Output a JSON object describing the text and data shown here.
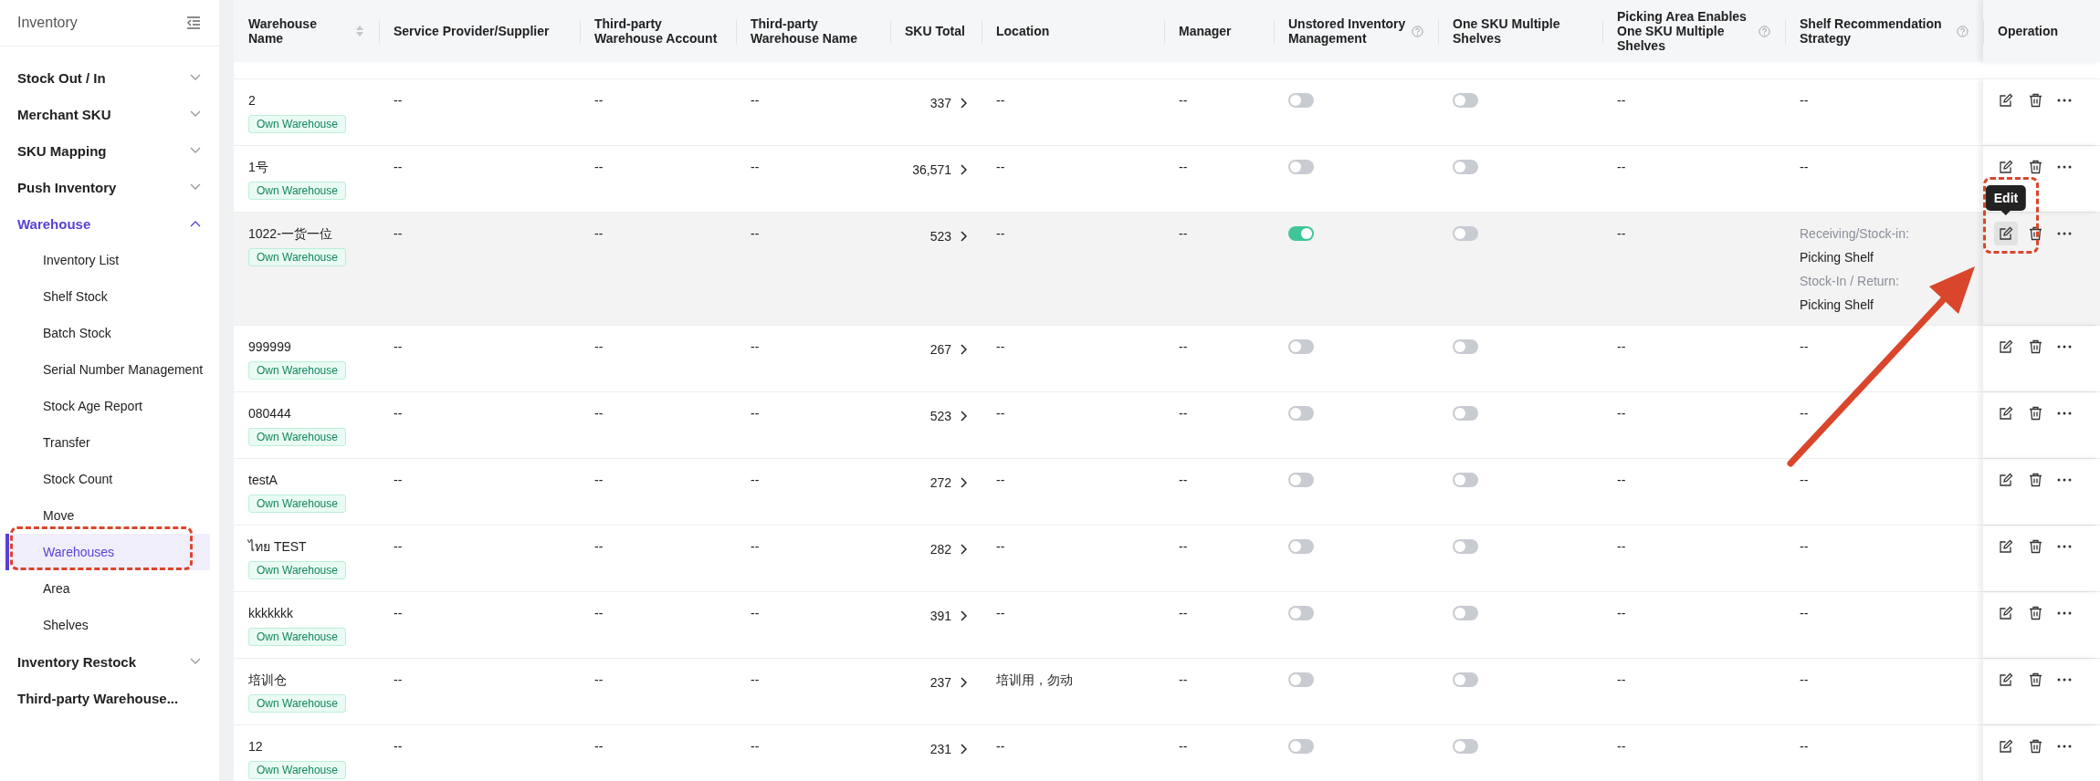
{
  "sidebar": {
    "title": "Inventory",
    "items": [
      {
        "kind": "group",
        "label": "Stock Out / In",
        "expanded": false
      },
      {
        "kind": "group",
        "label": "Merchant SKU",
        "expanded": false
      },
      {
        "kind": "group",
        "label": "SKU Mapping",
        "expanded": false
      },
      {
        "kind": "group",
        "label": "Push Inventory",
        "expanded": false
      },
      {
        "kind": "group",
        "label": "Warehouse",
        "expanded": true,
        "children": [
          {
            "label": "Inventory List",
            "selected": false
          },
          {
            "label": "Shelf Stock",
            "selected": false
          },
          {
            "label": "Batch Stock",
            "selected": false
          },
          {
            "label": "Serial Number Management",
            "selected": false
          },
          {
            "label": "Stock Age Report",
            "selected": false
          },
          {
            "label": "Transfer",
            "selected": false
          },
          {
            "label": "Stock Count",
            "selected": false
          },
          {
            "label": "Move",
            "selected": false
          },
          {
            "label": "Warehouses",
            "selected": true
          },
          {
            "label": "Area",
            "selected": false
          },
          {
            "label": "Shelves",
            "selected": false
          }
        ]
      },
      {
        "kind": "group",
        "label": "Inventory Restock",
        "expanded": false
      },
      {
        "kind": "link",
        "label": "Third-party Warehouse..."
      }
    ]
  },
  "table": {
    "columns": [
      {
        "label": "Warehouse Name",
        "sortable": true,
        "help": false
      },
      {
        "label": "Service Provider/Supplier",
        "sortable": false,
        "help": false
      },
      {
        "label": "Third-party Warehouse Account",
        "sortable": false,
        "help": false
      },
      {
        "label": "Third-party Warehouse Name",
        "sortable": false,
        "help": false
      },
      {
        "label": "SKU Total",
        "sortable": false,
        "help": false
      },
      {
        "label": "Location",
        "sortable": false,
        "help": false
      },
      {
        "label": "Manager",
        "sortable": false,
        "help": false
      },
      {
        "label": "Unstored Inventory Management",
        "sortable": false,
        "help": true
      },
      {
        "label": "One SKU Multiple Shelves",
        "sortable": false,
        "help": false
      },
      {
        "label": "Picking Area Enables One SKU Multiple Shelves",
        "sortable": false,
        "help": true
      },
      {
        "label": "Shelf Recommendation Strategy",
        "sortable": false,
        "help": true
      },
      {
        "label": "Operation",
        "sortable": false,
        "help": false
      }
    ],
    "rows": [
      {
        "name": "2",
        "tag": "Own Warehouse",
        "provider": "--",
        "account": "--",
        "tp_name": "--",
        "sku": "337",
        "location": "--",
        "manager": "--",
        "unstored": false,
        "multi_shelf": false,
        "picking": "--",
        "strategy": "--",
        "highlighted": false
      },
      {
        "name": "1号",
        "tag": "Own Warehouse",
        "provider": "--",
        "account": "--",
        "tp_name": "--",
        "sku": "36,571",
        "location": "--",
        "manager": "--",
        "unstored": false,
        "multi_shelf": false,
        "picking": "--",
        "strategy": "--",
        "highlighted": false
      },
      {
        "name": "1022-一货一位",
        "tag": "Own Warehouse",
        "provider": "--",
        "account": "--",
        "tp_name": "--",
        "sku": "523",
        "location": "--",
        "manager": "--",
        "unstored": true,
        "multi_shelf": false,
        "picking": "--",
        "strategy_lines": [
          {
            "label": "Receiving/Stock-in:",
            "value": "Picking Shelf"
          },
          {
            "label": "Stock-In / Return:",
            "value": "Picking Shelf"
          }
        ],
        "highlighted": true,
        "tooltip": "Edit"
      },
      {
        "name": "999999",
        "tag": "Own Warehouse",
        "provider": "--",
        "account": "--",
        "tp_name": "--",
        "sku": "267",
        "location": "--",
        "manager": "--",
        "unstored": false,
        "multi_shelf": false,
        "picking": "--",
        "strategy": "--",
        "highlighted": false
      },
      {
        "name": "080444",
        "tag": "Own Warehouse",
        "provider": "--",
        "account": "--",
        "tp_name": "--",
        "sku": "523",
        "location": "--",
        "manager": "--",
        "unstored": false,
        "multi_shelf": false,
        "picking": "--",
        "strategy": "--",
        "highlighted": false
      },
      {
        "name": "testA",
        "tag": "Own Warehouse",
        "provider": "--",
        "account": "--",
        "tp_name": "--",
        "sku": "272",
        "location": "--",
        "manager": "--",
        "unstored": false,
        "multi_shelf": false,
        "picking": "--",
        "strategy": "--",
        "highlighted": false
      },
      {
        "name": "ไทย TEST",
        "tag": "Own Warehouse",
        "provider": "--",
        "account": "--",
        "tp_name": "--",
        "sku": "282",
        "location": "--",
        "manager": "--",
        "unstored": false,
        "multi_shelf": false,
        "picking": "--",
        "strategy": "--",
        "highlighted": false
      },
      {
        "name": "kkkkkkk",
        "tag": "Own Warehouse",
        "provider": "--",
        "account": "--",
        "tp_name": "--",
        "sku": "391",
        "location": "--",
        "manager": "--",
        "unstored": false,
        "multi_shelf": false,
        "picking": "--",
        "strategy": "--",
        "highlighted": false
      },
      {
        "name": "培训仓",
        "tag": "Own Warehouse",
        "provider": "--",
        "account": "--",
        "tp_name": "--",
        "sku": "237",
        "location": "培训用，勿动",
        "manager": "--",
        "unstored": false,
        "multi_shelf": false,
        "picking": "--",
        "strategy": "--",
        "highlighted": false
      },
      {
        "name": "12",
        "tag": "Own Warehouse",
        "provider": "--",
        "account": "--",
        "tp_name": "--",
        "sku": "231",
        "location": "--",
        "manager": "--",
        "unstored": false,
        "multi_shelf": false,
        "picking": "--",
        "strategy": "--",
        "highlighted": false
      }
    ]
  }
}
